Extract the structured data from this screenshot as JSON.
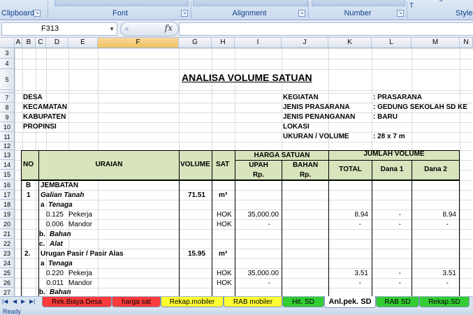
{
  "ribbon": {
    "groups": [
      "Clipboard",
      "Font",
      "Alignment",
      "Number",
      "Formatting ˇ as T",
      "Style"
    ]
  },
  "formula_bar": {
    "name_box": "F313",
    "fx": "fx",
    "value": ""
  },
  "columns": [
    "A",
    "B",
    "C",
    "D",
    "E",
    "F",
    "G",
    "H",
    "I",
    "J",
    "K",
    "L",
    "M",
    "N"
  ],
  "selected_column": "F",
  "rows": [
    "3",
    "4",
    "5",
    "6",
    "7",
    "8",
    "9",
    "10",
    "11",
    "12",
    "13",
    "14",
    "15",
    "16",
    "17",
    "18",
    "19",
    "20",
    "21",
    "22",
    "23",
    "24",
    "25",
    "26",
    "27"
  ],
  "sheet": {
    "title": "ANALISA VOLUME SATUAN",
    "info_left": [
      "DESA",
      "KECAMATAN",
      "KABUPATEN",
      "PROPINSI"
    ],
    "info_right": [
      {
        "label": "KEGIATAN",
        "value": ": PRASARANA"
      },
      {
        "label": "JENIS PRASARANA",
        "value": ": GEDUNG SEKOLAH SD KE"
      },
      {
        "label": "JENIS PENANGANAN",
        "value": ": BARU"
      },
      {
        "label": "LOKASI",
        "value": ""
      },
      {
        "label": "UKURAN / VOLUME",
        "value": ": 28 x 7 m"
      }
    ],
    "header": {
      "no": "NO",
      "uraian": "URAIAN",
      "volume": "VOLUME",
      "sat": "SAT",
      "harga_satuan": "HARGA SATUAN",
      "upah": "UPAH",
      "bahan": "BAHAN",
      "rp1": "Rp.",
      "rp2": "Rp.",
      "jumlah_volume": "JUMLAH VOLUME",
      "total": "TOTAL",
      "dana1": "Dana 1",
      "dana2": "Dana 2"
    },
    "body": {
      "r16_no": "B",
      "r16_text": "JEMBATAN",
      "r17_no": "1",
      "r17_text": "Galian Tanah",
      "r17_vol": "71.51",
      "r17_sat": "m³",
      "r18_a": "a",
      "r18_text": "Tenaga",
      "r19_coef": "0.125",
      "r19_text": "Pekerja",
      "r19_sat": "HOK",
      "r19_upah": "35,000.00",
      "r19_total": "8.94",
      "r19_dana1": "-",
      "r19_dana2": "8.94",
      "r20_coef": "0.006",
      "r20_text": "Mandor",
      "r20_sat": "HOK",
      "r20_upah": "-",
      "r20_total": "-",
      "r20_dana1": "-",
      "r20_dana2": "-",
      "r21_a": "b.",
      "r21_text": "Bahan",
      "r22_a": "c.",
      "r22_text": "Alat",
      "r23_no": "2.",
      "r23_text": "Urugan Pasir / Pasir Alas",
      "r23_vol": "15.95",
      "r23_sat": "m³",
      "r24_a": "a",
      "r24_text": "Tenaga",
      "r25_coef": "0.220",
      "r25_text": "Pekerja",
      "r25_sat": "HOK",
      "r25_upah": "35,000.00",
      "r25_total": "3.51",
      "r25_dana1": "-",
      "r25_dana2": "3.51",
      "r26_coef": "0.011",
      "r26_text": "Mandor",
      "r26_sat": "HOK",
      "r26_upah": "-",
      "r26_total": "-",
      "r26_dana1": "-",
      "r26_dana2": "-",
      "r27_a": "b.",
      "r27_text": "Bahan"
    }
  },
  "tabs": [
    {
      "label": "Rek.Biaya Desa",
      "color": "#ff3b3b"
    },
    {
      "label": "harga sat",
      "color": "#ff3b3b"
    },
    {
      "label": "Rekap.mobiler",
      "color": "#ffff33"
    },
    {
      "label": "RAB mobiler",
      "color": "#ffff33"
    },
    {
      "label": "Hit. SD",
      "color": "#33cc33"
    },
    {
      "label": "Anl.pek. SD",
      "color": "#ffffff"
    },
    {
      "label": "RAB SD",
      "color": "#33cc33"
    },
    {
      "label": "Rekap.SD",
      "color": "#33cc33"
    }
  ],
  "status": "Ready",
  "colors": {
    "header_fill": "#d8e4bc",
    "selected_header": "#f3c96a"
  }
}
